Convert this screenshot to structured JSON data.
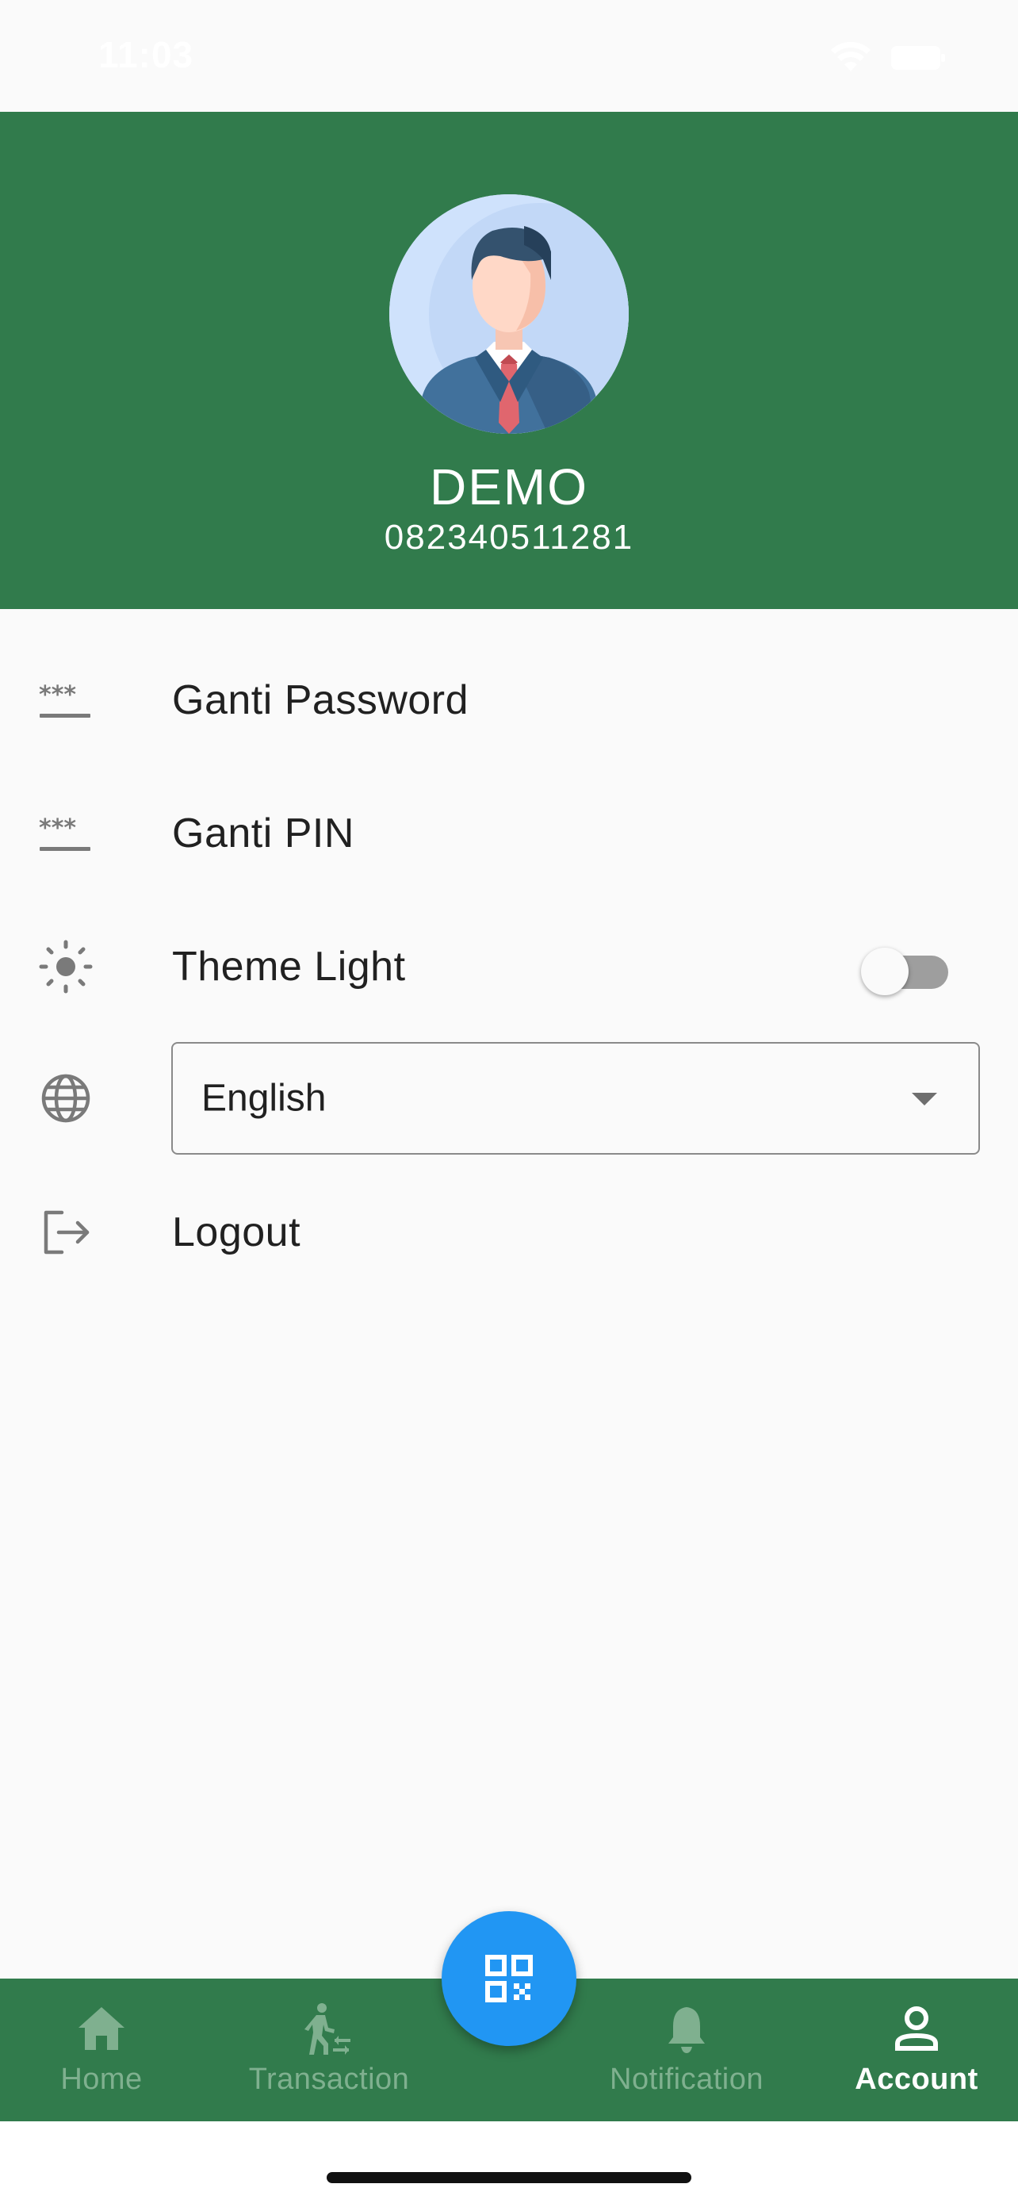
{
  "status_bar": {
    "time": "11:03"
  },
  "profile": {
    "name": "DEMO",
    "phone": "082340511281"
  },
  "menu": {
    "change_password": "Ganti Password",
    "change_pin": "Ganti PIN",
    "theme": "Theme Light",
    "theme_toggle_on": false,
    "language": "English",
    "logout": "Logout"
  },
  "bottom_nav": {
    "items": [
      {
        "label": "Home",
        "icon": "home-icon",
        "active": false
      },
      {
        "label": "Transaction",
        "icon": "transaction-icon",
        "active": false
      },
      {
        "label": "Notification",
        "icon": "bell-icon",
        "active": false
      },
      {
        "label": "Account",
        "icon": "account-icon",
        "active": true
      }
    ],
    "fab_icon": "qr-code-icon"
  },
  "colors": {
    "header": "#317b4c",
    "fab": "#2196f3",
    "nav_inactive": "#7fb08f",
    "nav_active": "#ffffff"
  }
}
